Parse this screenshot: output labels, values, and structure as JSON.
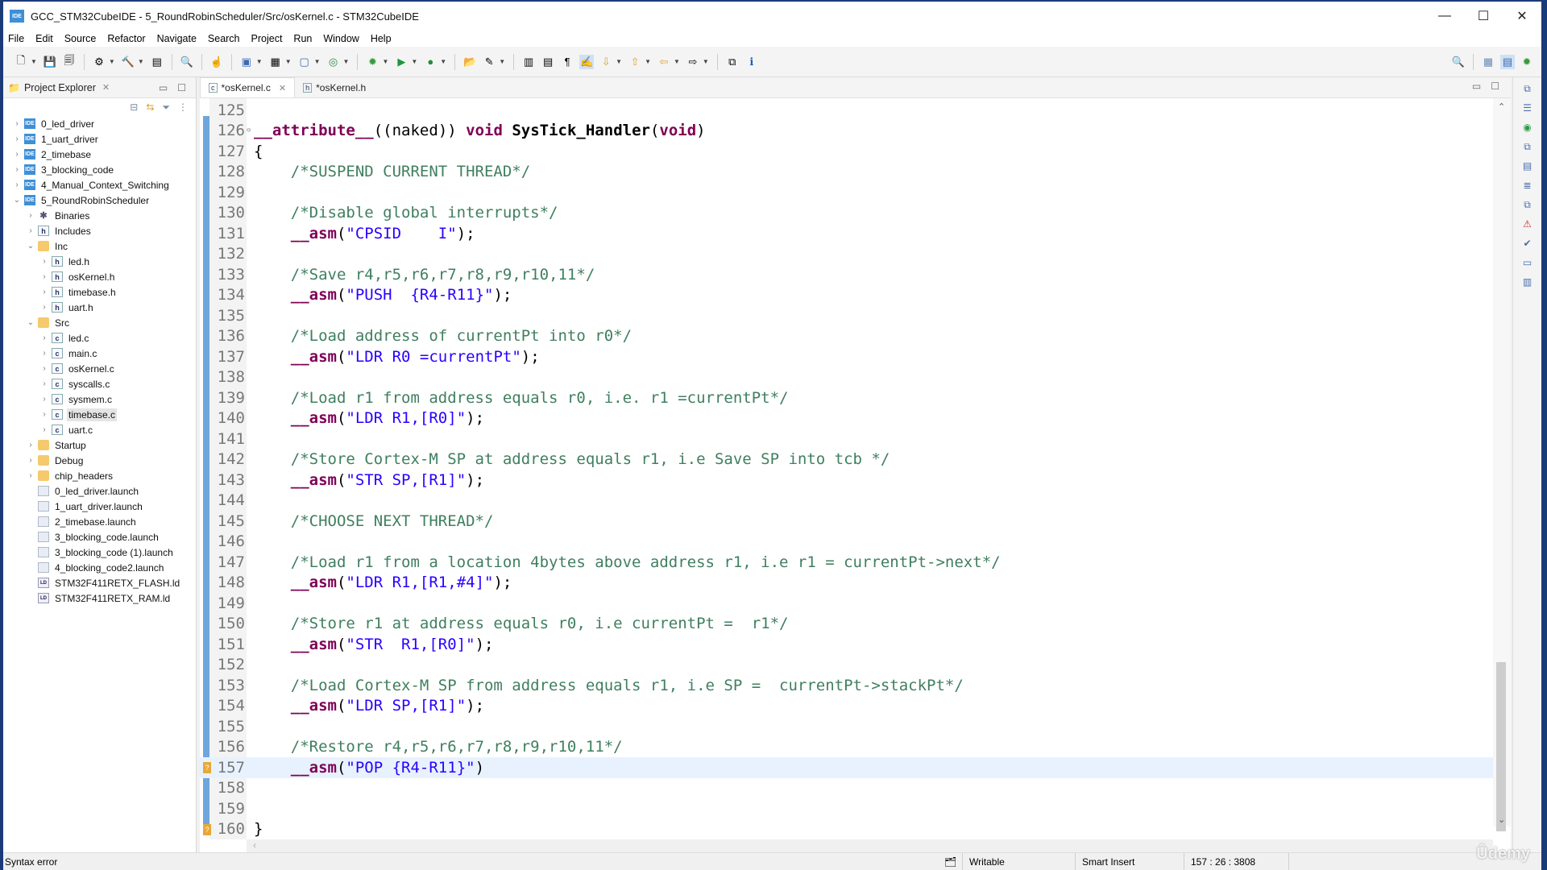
{
  "window": {
    "title": "GCC_STM32CubeIDE - 5_RoundRobinScheduler/Src/osKernel.c - STM32CubeIDE",
    "app_icon": "IDE",
    "controls": {
      "minimize": "—",
      "maximize": "☐",
      "close": "✕"
    }
  },
  "menu": [
    "File",
    "Edit",
    "Source",
    "Refactor",
    "Navigate",
    "Search",
    "Project",
    "Run",
    "Window",
    "Help"
  ],
  "toolbar": {
    "icons": [
      "new-icon",
      "save-icon",
      "save-all-icon",
      "build-config-icon",
      "build-hammer-icon",
      "binary-icon",
      "search-debug-icon",
      "touch-icon",
      "new-c-project-icon",
      "new-folder-icon",
      "new-c-file-icon",
      "new-class-icon",
      "debug-bug-icon",
      "run-icon",
      "external-tools-icon",
      "open-folder-icon",
      "pen-icon",
      "toggle-mark-icon",
      "block-icon",
      "pilcrow-icon",
      "highlight-icon",
      "next-annotation-icon",
      "prev-annotation-icon",
      "back-icon",
      "forward-icon",
      "open-perspective-icon",
      "info-icon"
    ]
  },
  "explorer": {
    "title": "Project Explorer",
    "tree": [
      {
        "label": "0_led_driver",
        "icon": "ide",
        "depth": 0,
        "state": "collapsed"
      },
      {
        "label": "1_uart_driver",
        "icon": "ide",
        "depth": 0,
        "state": "collapsed"
      },
      {
        "label": "2_timebase",
        "icon": "ide",
        "depth": 0,
        "state": "collapsed"
      },
      {
        "label": "3_blocking_code",
        "icon": "ide",
        "depth": 0,
        "state": "collapsed"
      },
      {
        "label": "4_Manual_Context_Switching",
        "icon": "ide",
        "depth": 0,
        "state": "collapsed"
      },
      {
        "label": "5_RoundRobinScheduler",
        "icon": "ide",
        "depth": 0,
        "state": "expanded"
      },
      {
        "label": "Binaries",
        "icon": "bin",
        "depth": 1,
        "state": "collapsed"
      },
      {
        "label": "Includes",
        "icon": "inc",
        "depth": 1,
        "state": "collapsed"
      },
      {
        "label": "Inc",
        "icon": "folder",
        "depth": 1,
        "state": "expanded"
      },
      {
        "label": "led.h",
        "icon": "h",
        "depth": 2,
        "state": "collapsed"
      },
      {
        "label": "osKernel.h",
        "icon": "h",
        "depth": 2,
        "state": "collapsed"
      },
      {
        "label": "timebase.h",
        "icon": "h",
        "depth": 2,
        "state": "collapsed"
      },
      {
        "label": "uart.h",
        "icon": "h",
        "depth": 2,
        "state": "collapsed"
      },
      {
        "label": "Src",
        "icon": "folder",
        "depth": 1,
        "state": "expanded"
      },
      {
        "label": "led.c",
        "icon": "c",
        "depth": 2,
        "state": "collapsed"
      },
      {
        "label": "main.c",
        "icon": "c",
        "depth": 2,
        "state": "collapsed"
      },
      {
        "label": "osKernel.c",
        "icon": "c",
        "depth": 2,
        "state": "collapsed"
      },
      {
        "label": "syscalls.c",
        "icon": "c",
        "depth": 2,
        "state": "collapsed"
      },
      {
        "label": "sysmem.c",
        "icon": "c",
        "depth": 2,
        "state": "collapsed"
      },
      {
        "label": "timebase.c",
        "icon": "c",
        "depth": 2,
        "state": "collapsed",
        "selected": true
      },
      {
        "label": "uart.c",
        "icon": "c",
        "depth": 2,
        "state": "collapsed"
      },
      {
        "label": "Startup",
        "icon": "folder",
        "depth": 1,
        "state": "collapsed"
      },
      {
        "label": "Debug",
        "icon": "folder",
        "depth": 1,
        "state": "collapsed"
      },
      {
        "label": "chip_headers",
        "icon": "folder",
        "depth": 1,
        "state": "collapsed"
      },
      {
        "label": "0_led_driver.launch",
        "icon": "file",
        "depth": 1,
        "state": "leaf"
      },
      {
        "label": "1_uart_driver.launch",
        "icon": "file",
        "depth": 1,
        "state": "leaf"
      },
      {
        "label": "2_timebase.launch",
        "icon": "file",
        "depth": 1,
        "state": "leaf"
      },
      {
        "label": "3_blocking_code.launch",
        "icon": "file",
        "depth": 1,
        "state": "leaf"
      },
      {
        "label": "3_blocking_code (1).launch",
        "icon": "file",
        "depth": 1,
        "state": "leaf"
      },
      {
        "label": "4_blocking_code2.launch",
        "icon": "file",
        "depth": 1,
        "state": "leaf"
      },
      {
        "label": "STM32F411RETX_FLASH.ld",
        "icon": "ld",
        "depth": 1,
        "state": "leaf"
      },
      {
        "label": "STM32F411RETX_RAM.ld",
        "icon": "ld",
        "depth": 1,
        "state": "leaf"
      }
    ]
  },
  "editor": {
    "tabs": [
      {
        "label": "*osKernel.c",
        "icon": "c",
        "active": true
      },
      {
        "label": "*osKernel.h",
        "icon": "h",
        "active": false
      }
    ],
    "current_line": 157,
    "lines": [
      {
        "n": "125",
        "tokens": []
      },
      {
        "n": "126",
        "fold": true,
        "tokens": [
          [
            "kw",
            "__attribute__"
          ],
          [
            "pl",
            "(("
          ],
          [
            "pl",
            "naked"
          ],
          [
            "pl",
            ")) "
          ],
          [
            "kw",
            "void"
          ],
          [
            "pl",
            " "
          ],
          [
            "fn",
            "SysTick_Handler"
          ],
          [
            "pl",
            "("
          ],
          [
            "kw",
            "void"
          ],
          [
            "pl",
            ")"
          ]
        ]
      },
      {
        "n": "127",
        "tokens": [
          [
            "pl",
            "{"
          ]
        ]
      },
      {
        "n": "128",
        "tokens": [
          [
            "pl",
            "    "
          ],
          [
            "cm",
            "/*SUSPEND CURRENT THREAD*/"
          ]
        ]
      },
      {
        "n": "129",
        "tokens": []
      },
      {
        "n": "130",
        "tokens": [
          [
            "pl",
            "    "
          ],
          [
            "cm",
            "/*Disable global interrupts*/"
          ]
        ]
      },
      {
        "n": "131",
        "tokens": [
          [
            "pl",
            "    "
          ],
          [
            "kw",
            "__asm"
          ],
          [
            "pl",
            "("
          ],
          [
            "st",
            "\"CPSID    I\""
          ],
          [
            "pl",
            ");"
          ]
        ]
      },
      {
        "n": "132",
        "tokens": []
      },
      {
        "n": "133",
        "tokens": [
          [
            "pl",
            "    "
          ],
          [
            "cm",
            "/*Save r4,r5,r6,r7,r8,r9,r10,11*/"
          ]
        ]
      },
      {
        "n": "134",
        "tokens": [
          [
            "pl",
            "    "
          ],
          [
            "kw",
            "__asm"
          ],
          [
            "pl",
            "("
          ],
          [
            "st",
            "\"PUSH  {R4-R11}\""
          ],
          [
            "pl",
            ");"
          ]
        ]
      },
      {
        "n": "135",
        "tokens": []
      },
      {
        "n": "136",
        "tokens": [
          [
            "pl",
            "    "
          ],
          [
            "cm",
            "/*Load address of currentPt into r0*/"
          ]
        ]
      },
      {
        "n": "137",
        "tokens": [
          [
            "pl",
            "    "
          ],
          [
            "kw",
            "__asm"
          ],
          [
            "pl",
            "("
          ],
          [
            "st",
            "\"LDR R0 =currentPt\""
          ],
          [
            "pl",
            ");"
          ]
        ]
      },
      {
        "n": "138",
        "tokens": []
      },
      {
        "n": "139",
        "tokens": [
          [
            "pl",
            "    "
          ],
          [
            "cm",
            "/*Load r1 from address equals r0, i.e. r1 =currentPt*/"
          ]
        ]
      },
      {
        "n": "140",
        "tokens": [
          [
            "pl",
            "    "
          ],
          [
            "kw",
            "__asm"
          ],
          [
            "pl",
            "("
          ],
          [
            "st",
            "\"LDR R1,[R0]\""
          ],
          [
            "pl",
            ");"
          ]
        ]
      },
      {
        "n": "141",
        "tokens": []
      },
      {
        "n": "142",
        "tokens": [
          [
            "pl",
            "    "
          ],
          [
            "cm",
            "/*Store Cortex-M SP at address equals r1, i.e Save SP into tcb */"
          ]
        ]
      },
      {
        "n": "143",
        "tokens": [
          [
            "pl",
            "    "
          ],
          [
            "kw",
            "__asm"
          ],
          [
            "pl",
            "("
          ],
          [
            "st",
            "\"STR SP,[R1]\""
          ],
          [
            "pl",
            ");"
          ]
        ]
      },
      {
        "n": "144",
        "tokens": []
      },
      {
        "n": "145",
        "tokens": [
          [
            "pl",
            "    "
          ],
          [
            "cm",
            "/*CHOOSE NEXT THREAD*/"
          ]
        ]
      },
      {
        "n": "146",
        "tokens": []
      },
      {
        "n": "147",
        "tokens": [
          [
            "pl",
            "    "
          ],
          [
            "cm",
            "/*Load r1 from a location 4bytes above address r1, i.e r1 = currentPt->next*/"
          ]
        ]
      },
      {
        "n": "148",
        "tokens": [
          [
            "pl",
            "    "
          ],
          [
            "kw",
            "__asm"
          ],
          [
            "pl",
            "("
          ],
          [
            "st",
            "\"LDR R1,[R1,#4]\""
          ],
          [
            "pl",
            ");"
          ]
        ]
      },
      {
        "n": "149",
        "tokens": []
      },
      {
        "n": "150",
        "tokens": [
          [
            "pl",
            "    "
          ],
          [
            "cm",
            "/*Store r1 at address equals r0, i.e currentPt =  r1*/"
          ]
        ]
      },
      {
        "n": "151",
        "tokens": [
          [
            "pl",
            "    "
          ],
          [
            "kw",
            "__asm"
          ],
          [
            "pl",
            "("
          ],
          [
            "st",
            "\"STR  R1,[R0]\""
          ],
          [
            "pl",
            ");"
          ]
        ]
      },
      {
        "n": "152",
        "tokens": []
      },
      {
        "n": "153",
        "tokens": [
          [
            "pl",
            "    "
          ],
          [
            "cm",
            "/*Load Cortex-M SP from address equals r1, i.e SP =  currentPt->stackPt*/"
          ]
        ]
      },
      {
        "n": "154",
        "tokens": [
          [
            "pl",
            "    "
          ],
          [
            "kw",
            "__asm"
          ],
          [
            "pl",
            "("
          ],
          [
            "st",
            "\"LDR SP,[R1]\""
          ],
          [
            "pl",
            ");"
          ]
        ]
      },
      {
        "n": "155",
        "tokens": []
      },
      {
        "n": "156",
        "tokens": [
          [
            "pl",
            "    "
          ],
          [
            "cm",
            "/*Restore r4,r5,r6,r7,r8,r9,r10,11*/"
          ]
        ]
      },
      {
        "n": "157",
        "warning": true,
        "tokens": [
          [
            "pl",
            "    "
          ],
          [
            "kw",
            "__asm"
          ],
          [
            "pl",
            "("
          ],
          [
            "st",
            "\"POP {R4-R11}\""
          ],
          [
            "pl",
            ")"
          ]
        ]
      },
      {
        "n": "158",
        "tokens": []
      },
      {
        "n": "159",
        "tokens": []
      },
      {
        "n": "160",
        "warning": true,
        "tokens": [
          [
            "pl",
            "}"
          ]
        ]
      }
    ]
  },
  "right_trim_icons": [
    "restore-icon",
    "outline-icon",
    "build-analyzer-icon",
    "restore-icon-2",
    "memory-icon",
    "sfr-icon",
    "restore-icon-3",
    "fault-analyzer-icon",
    "tasks-icon",
    "console-icon",
    "layout-icon"
  ],
  "statusbar": {
    "message": "Syntax error",
    "writable": "Writable",
    "insert_mode": "Smart Insert",
    "position": "157 : 26 : 3808"
  },
  "watermark": "Ûdemy"
}
